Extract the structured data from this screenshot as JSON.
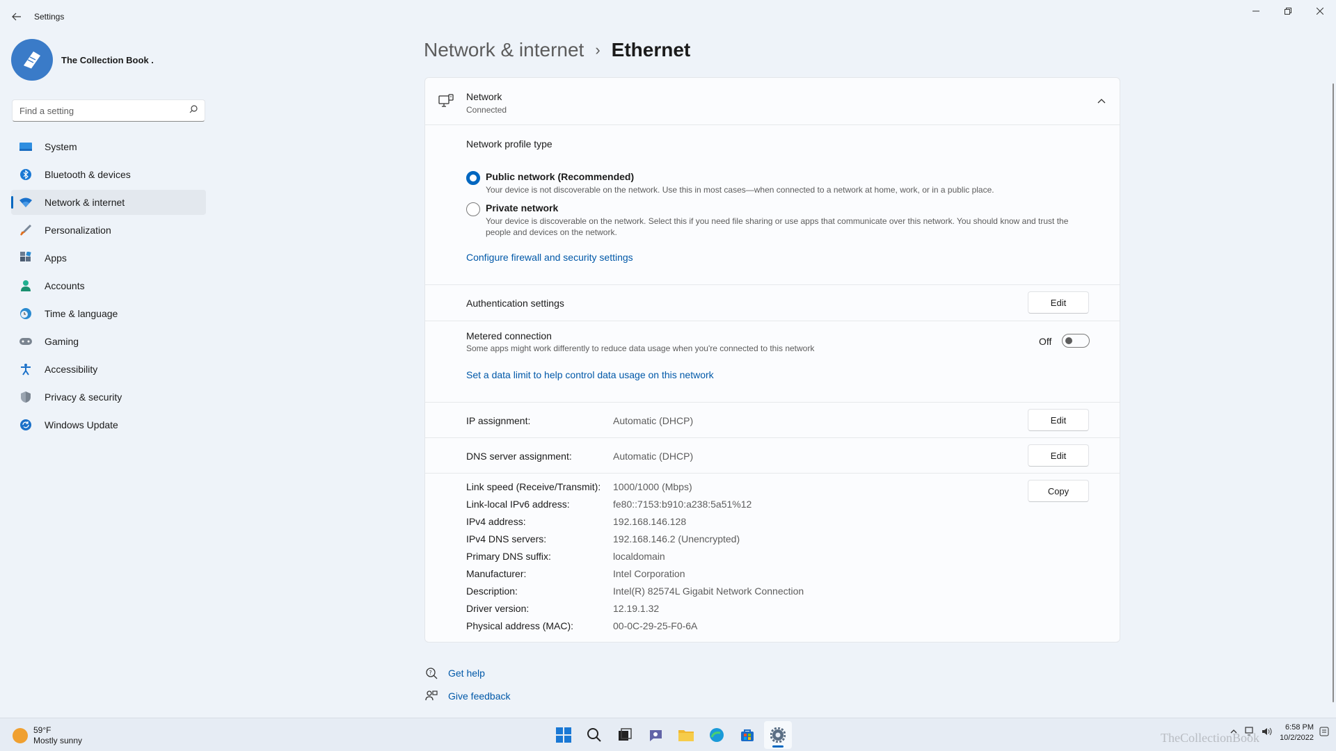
{
  "window": {
    "title": "Settings",
    "controls": [
      "minimize",
      "restore",
      "close"
    ]
  },
  "profile": {
    "name": "The Collection Book ."
  },
  "search": {
    "placeholder": "Find a setting"
  },
  "sidebar": {
    "items": [
      {
        "label": "System",
        "icon": "system-icon",
        "color": "#0078d4"
      },
      {
        "label": "Bluetooth & devices",
        "icon": "bluetooth-icon",
        "color": "#0078d4"
      },
      {
        "label": "Network & internet",
        "icon": "wifi-icon",
        "color": "#0067c0",
        "active": true
      },
      {
        "label": "Personalization",
        "icon": "brush-icon",
        "color": "#e07020"
      },
      {
        "label": "Apps",
        "icon": "apps-icon",
        "color": "#4a5b70"
      },
      {
        "label": "Accounts",
        "icon": "accounts-icon",
        "color": "#20a080"
      },
      {
        "label": "Time & language",
        "icon": "clock-globe-icon",
        "color": "#2a8ad0"
      },
      {
        "label": "Gaming",
        "icon": "gamepad-icon",
        "color": "#6a7480"
      },
      {
        "label": "Accessibility",
        "icon": "accessibility-icon",
        "color": "#1a70c8"
      },
      {
        "label": "Privacy & security",
        "icon": "shield-icon",
        "color": "#6a7480"
      },
      {
        "label": "Windows Update",
        "icon": "update-icon",
        "color": "#1a70c8"
      }
    ]
  },
  "breadcrumb": {
    "parent": "Network & internet",
    "separator": "›",
    "current": "Ethernet"
  },
  "network": {
    "title": "Network",
    "status": "Connected",
    "profile_type_label": "Network profile type",
    "public": {
      "title": "Public network (Recommended)",
      "desc": "Your device is not discoverable on the network. Use this in most cases—when connected to a network at home, work, or in a public place.",
      "selected": true
    },
    "private": {
      "title": "Private network",
      "desc": "Your device is discoverable on the network. Select this if you need file sharing or use apps that communicate over this network. You should know and trust the people and devices on the network.",
      "selected": false
    },
    "firewall_link": "Configure firewall and security settings",
    "auth_label": "Authentication settings",
    "edit_label": "Edit",
    "metered": {
      "label": "Metered connection",
      "desc": "Some apps might work differently to reduce data usage when you're connected to this network",
      "state": "Off",
      "data_limit_link": "Set a data limit to help control data usage on this network"
    },
    "ip_assignment": {
      "label": "IP assignment:",
      "value": "Automatic (DHCP)"
    },
    "dns_assignment": {
      "label": "DNS server assignment:",
      "value": "Automatic (DHCP)"
    },
    "copy_label": "Copy",
    "properties": [
      {
        "label": "Link speed (Receive/Transmit):",
        "value": "1000/1000 (Mbps)"
      },
      {
        "label": "Link-local IPv6 address:",
        "value": "fe80::7153:b910:a238:5a51%12"
      },
      {
        "label": "IPv4 address:",
        "value": "192.168.146.128"
      },
      {
        "label": "IPv4 DNS servers:",
        "value": "192.168.146.2 (Unencrypted)"
      },
      {
        "label": "Primary DNS suffix:",
        "value": "localdomain"
      },
      {
        "label": "Manufacturer:",
        "value": "Intel Corporation"
      },
      {
        "label": "Description:",
        "value": "Intel(R) 82574L Gigabit Network Connection"
      },
      {
        "label": "Driver version:",
        "value": "12.19.1.32"
      },
      {
        "label": "Physical address (MAC):",
        "value": "00-0C-29-25-F0-6A"
      }
    ]
  },
  "help": {
    "get_help": "Get help",
    "give_feedback": "Give feedback"
  },
  "taskbar": {
    "weather_temp": "59°F",
    "weather_desc": "Mostly sunny",
    "apps": [
      "windows-start-icon",
      "search-icon",
      "task-view-icon",
      "teams-chat-icon",
      "file-explorer-icon",
      "edge-icon",
      "store-icon",
      "settings-icon"
    ],
    "watermark": "TheCollectionBook",
    "time": "6:58 PM",
    "date": "10/2/2022"
  }
}
